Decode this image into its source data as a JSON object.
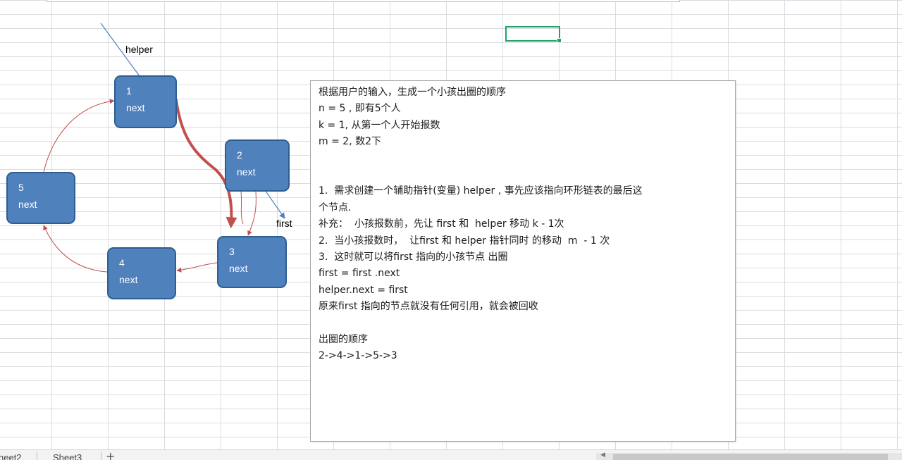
{
  "diagram": {
    "nodes": [
      {
        "id": "1",
        "field": "next"
      },
      {
        "id": "2",
        "field": "next"
      },
      {
        "id": "3",
        "field": "next"
      },
      {
        "id": "4",
        "field": "next"
      },
      {
        "id": "5",
        "field": "next"
      }
    ],
    "pointers": {
      "helper": "helper",
      "first": "first"
    },
    "colors": {
      "node_fill": "#4f81bd",
      "node_border": "#2e5d91",
      "link_arrow": "#c0504d",
      "move_arrow": "#c0504d",
      "pointer_line": "#4f81bd"
    }
  },
  "note": {
    "lines": [
      "根据用户的输入，生成一个小孩出圈的顺序",
      "n = 5 , 即有5个人",
      "k = 1, 从第一个人开始报数",
      "m = 2, 数2下",
      "",
      "",
      "1.  需求创建一个辅助指针(变量) helper , 事先应该指向环形链表的最后这",
      "个节点.",
      "补充：  小孩报数前，先让 first 和  helper 移动 k - 1次",
      "2.  当小孩报数时，  让first 和 helper 指针同时 的移动  m  - 1 次",
      "3.  这时就可以将first 指向的小孩节点 出圈",
      "first = first .next",
      "helper.next = first",
      "原来first 指向的节点就没有任何引用，就会被回收",
      "",
      "出圈的顺序",
      "2->4->1->5->3"
    ]
  },
  "tabs": {
    "sheet_tab_1": "heet2",
    "sheet_tab_2": "Sheet3",
    "add_sheet": "+"
  },
  "selection": {
    "color": "#21a366"
  }
}
